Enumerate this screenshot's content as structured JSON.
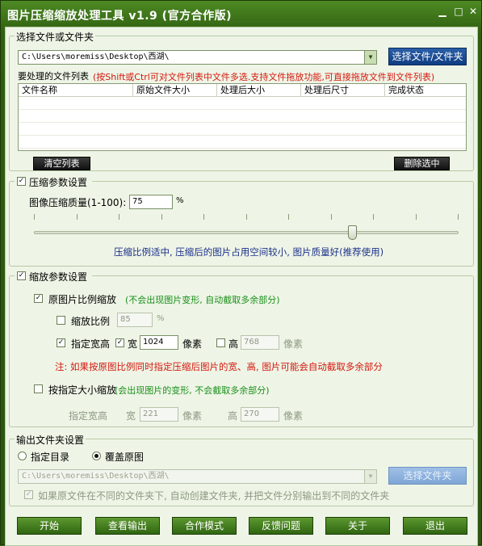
{
  "window": {
    "title": "图片压缩缩放处理工具 v1.9 (官方合作版)",
    "controls": [
      "▁",
      "□",
      "✕"
    ]
  },
  "file_group": {
    "title": "选择文件或文件夹",
    "path": "C:\\Users\\moremiss\\Desktop\\西湖\\",
    "browse_button": "选择文件/文件夹",
    "list_label": "要处理的文件列表",
    "list_hint": "(按Shift或Ctrl可对文件列表中文件多选.支持文件拖放功能,可直接拖放文件到文件列表)",
    "columns": [
      "文件名称",
      "原始文件大小",
      "处理后大小",
      "处理后尺寸",
      "完成状态"
    ],
    "clear_button": "清空列表",
    "delete_button": "删除选中"
  },
  "compress_group": {
    "title": "压缩参数设置",
    "checked": true,
    "quality_label": "图像压缩质量(1-100):",
    "quality_value": "75",
    "quality_unit": "%",
    "quality_level": 75,
    "hint": "压缩比例适中, 压缩后的图片占用空间较小, 图片质量好(推荐使用)"
  },
  "scale_group": {
    "title": "缩放参数设置",
    "checked": true,
    "proportional_label": "原图片比例缩放",
    "proportional_hint": "(不会出现图片变形, 自动截取多余部分)",
    "ratio_label": "缩放比例",
    "ratio_value": "85",
    "ratio_unit": "%",
    "specify_label": "指定宽高",
    "width_label": "宽",
    "width_value": "1024",
    "width_unit": "像素",
    "height_label": "高",
    "height_value": "768",
    "height_unit": "像素",
    "note": "注: 如果按原图比例同时指定压缩后图片的宽、高, 图片可能会自动截取多余部分",
    "size_label": "按指定大小缩放",
    "size_hint": "(会出现图片的变形, 不会截取多余部分)",
    "size_specify_label": "指定宽高",
    "size_width_label": "宽",
    "size_width_value": "221",
    "size_width_unit": "像素",
    "size_height_label": "高",
    "size_height_value": "270",
    "size_height_unit": "像素"
  },
  "output_group": {
    "title": "输出文件夹设置",
    "option_dir": "指定目录",
    "option_overwrite": "覆盖原图",
    "path": "C:\\Users\\moremiss\\Desktop\\西湖\\",
    "browse_button": "选择文件夹",
    "subfolder_label": "如果原文件在不同的文件夹下, 自动创建文件夹, 并把文件分别输出到不同的文件夹"
  },
  "bottom_buttons": {
    "start": "开始",
    "view_output": "查看输出",
    "collab_mode": "合作模式",
    "feedback": "反馈问题",
    "about": "关于",
    "exit": "退出"
  },
  "colors": {
    "frame": "#2f5e10",
    "client_bg": "#eef5e6",
    "hint_red": "#d4180f",
    "hint_blue": "#1b2f8a",
    "hint_green": "#1a8f1a"
  }
}
